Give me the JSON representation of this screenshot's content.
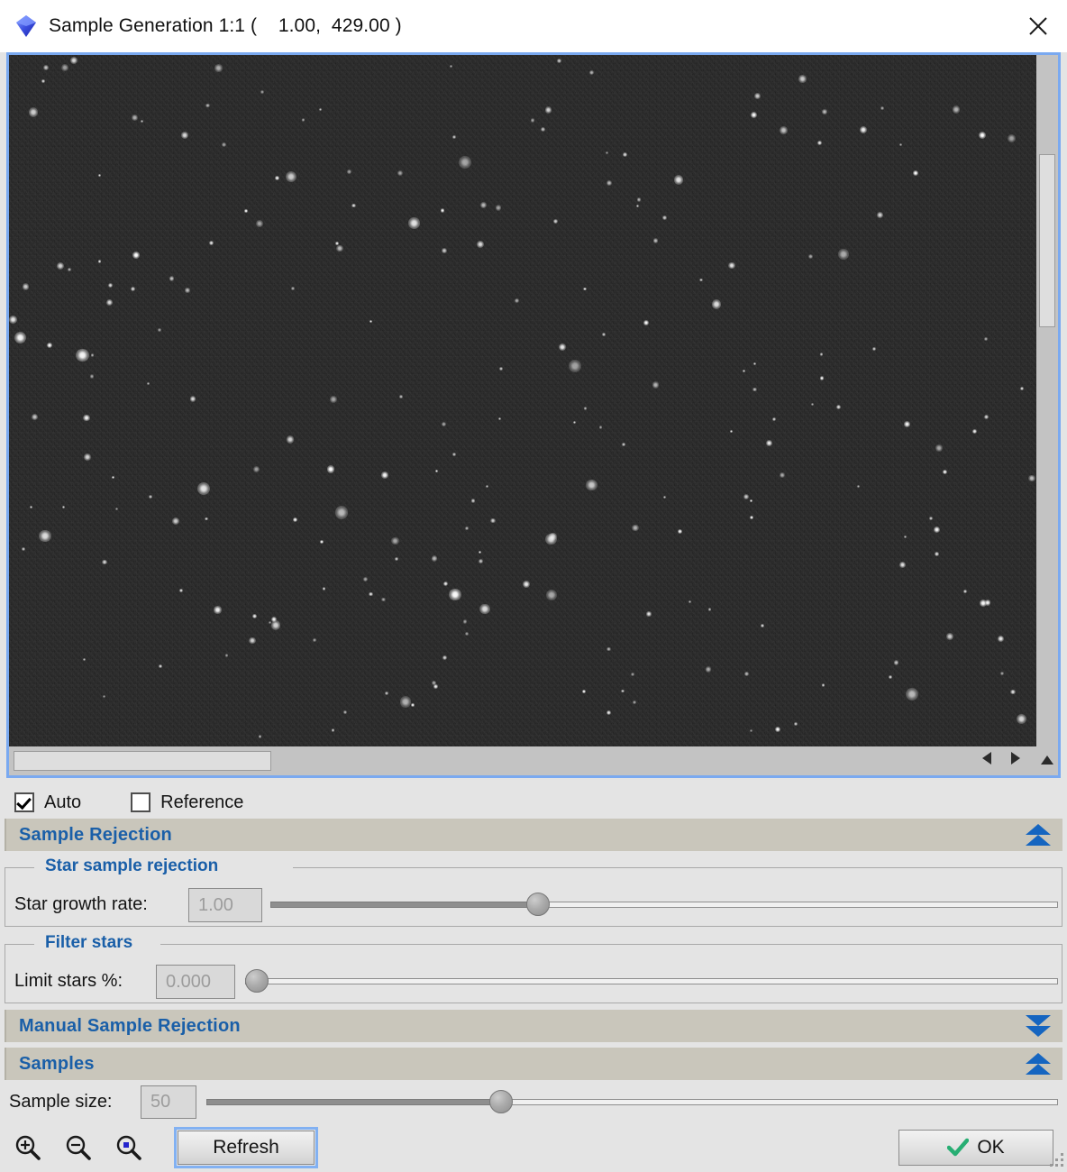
{
  "window": {
    "title": "Sample Generation 1:1 (    1.00,  429.00 )",
    "icon": "diamond-icon",
    "close_icon": "close-icon"
  },
  "preview": {
    "name": "image-preview",
    "vertical_scrollbar": "vertical-scrollbar",
    "horizontal_scrollbar": "horizontal-scrollbar",
    "scroll_up_icon": "arrow-up-icon",
    "scroll_down_icon": "arrow-down-icon",
    "scroll_left_icon": "arrow-left-icon",
    "scroll_right_icon": "arrow-right-icon"
  },
  "checkboxes": [
    {
      "label": "Auto",
      "checked": true
    },
    {
      "label": "Reference",
      "checked": false
    }
  ],
  "sections": [
    {
      "title": "Sample Rejection",
      "collapse_icon": "double-chevron-up-icon",
      "expanded": true
    },
    {
      "title": "Manual Sample Rejection",
      "collapse_icon": "double-chevron-down-icon",
      "expanded": false
    },
    {
      "title": "Samples",
      "collapse_icon": "double-chevron-up-icon",
      "expanded": true
    }
  ],
  "groups": [
    {
      "legend": "Star sample rejection"
    },
    {
      "legend": "Filter stars"
    }
  ],
  "fields": {
    "star_growth_rate": {
      "label": "Star growth rate:",
      "value": "1.00",
      "slider_percent": 34
    },
    "limit_stars": {
      "label": "Limit stars %:",
      "value": "0.000",
      "slider_percent": 0
    },
    "sample_size": {
      "label": "Sample size:",
      "value": "50",
      "slider_percent": 33
    }
  },
  "toolbar": {
    "zoom_in_icon": "zoom-in-icon",
    "zoom_out_icon": "zoom-out-icon",
    "zoom_fit_icon": "zoom-fit-icon",
    "refresh_label": "Refresh",
    "ok_label": "OK",
    "ok_icon": "check-icon"
  },
  "colors": {
    "accent_blue": "#1a5fa8",
    "focus_blue": "#82b1f2",
    "header_bg": "#c9c6bb",
    "panel_bg": "#e4e4e4",
    "check_green": "#27ae73"
  }
}
